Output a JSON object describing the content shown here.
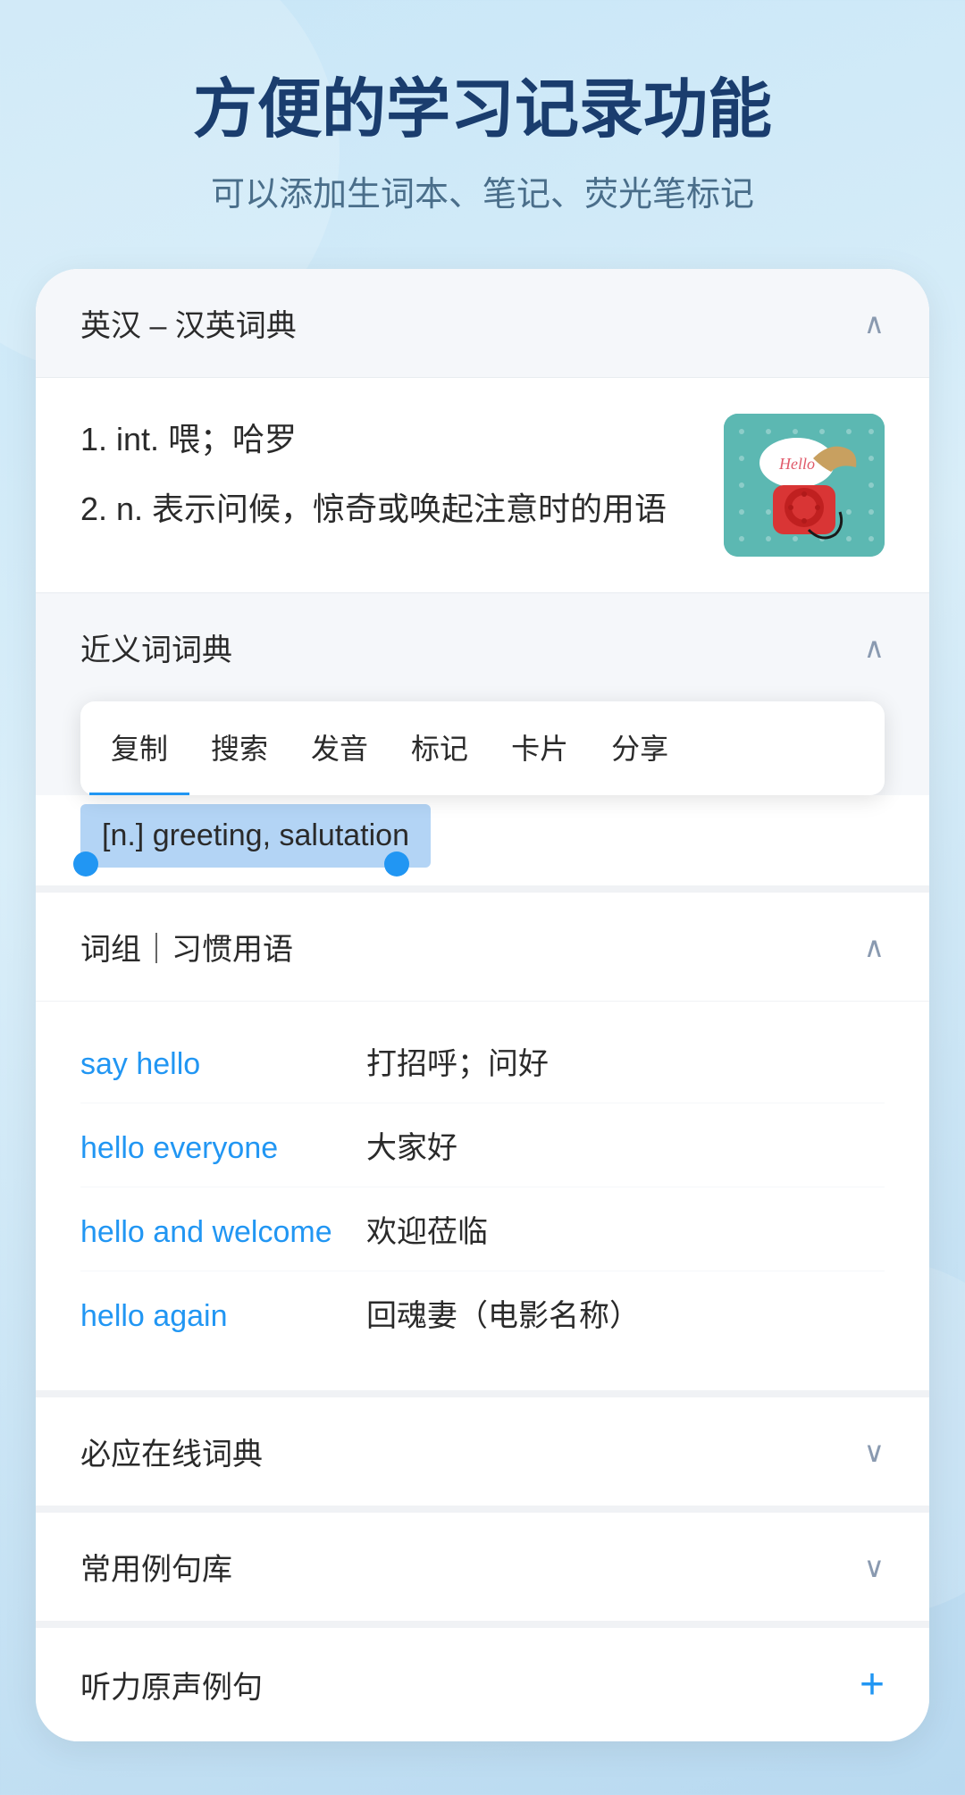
{
  "header": {
    "title": "方便的学习记录功能",
    "subtitle": "可以添加生词本、笔记、荧光笔标记"
  },
  "dictSection": {
    "title": "英汉 – 汉英词典",
    "chevron": "∧",
    "def1": "1. int. 喂；哈罗",
    "def2": "2. n. 表示问候，惊奇或唤起注意时的用语",
    "imageSpeechBubble": "Hello"
  },
  "synonymsSection": {
    "title": "近义词词典",
    "chevron": "∧",
    "contextMenu": {
      "items": [
        "复制",
        "搜索",
        "发音",
        "标记",
        "卡片",
        "分享"
      ]
    },
    "selectedText": "[n.] greeting, salutation"
  },
  "phrasesSection": {
    "title": "词组｜习惯用语",
    "chevron": "∧",
    "phrases": [
      {
        "en": "say hello",
        "zh": "打招呼；问好"
      },
      {
        "en": "hello everyone",
        "zh": "大家好"
      },
      {
        "en": "hello and welcome",
        "zh": "欢迎莅临"
      },
      {
        "en": "hello again",
        "zh": "回魂妻（电影名称）"
      }
    ]
  },
  "bottomSections": [
    {
      "title": "必应在线词典",
      "icon": "chevron-down",
      "hasPlus": false
    },
    {
      "title": "常用例句库",
      "icon": "chevron-down",
      "hasPlus": false
    },
    {
      "title": "听力原声例句",
      "icon": "plus",
      "hasPlus": true
    }
  ]
}
